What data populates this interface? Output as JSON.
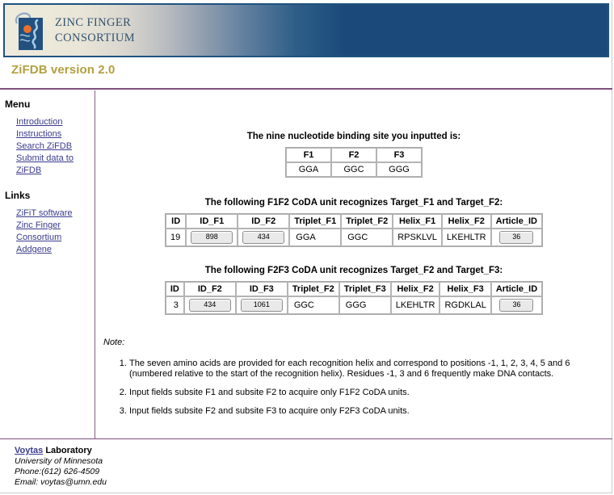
{
  "banner": {
    "title": "ZINC FINGER\nCONSORTIUM",
    "logo_icon": "zinc-finger-logo-icon",
    "colors": {
      "dark_blue": "#1b4a7a",
      "cream": "#eeeadc",
      "text": "#33536f"
    }
  },
  "version_bar": {
    "text": "ZiFDB version 2.0",
    "color": "#b3a03f"
  },
  "sidebar": {
    "menu_heading": "Menu",
    "menu_items": [
      {
        "label": "Introduction"
      },
      {
        "label": "Instructions"
      },
      {
        "label": "Search ZiFDB"
      },
      {
        "label": "Submit data to ZiFDB"
      }
    ],
    "links_heading": "Links",
    "links_items": [
      {
        "label": "ZiFiT software"
      },
      {
        "label": "Zinc Finger Consortium"
      },
      {
        "label": "Addgene"
      }
    ],
    "link_color": "#3b3b8f"
  },
  "main": {
    "input_section": {
      "heading": "The nine nucleotide binding site you inputted is:",
      "headers": [
        "F1",
        "F2",
        "F3"
      ],
      "values": [
        "GGA",
        "GGC",
        "GGG"
      ]
    },
    "f1f2_section": {
      "heading": "The following F1F2 CoDA unit recognizes Target_F1 and Target_F2:",
      "headers": [
        "ID",
        "ID_F1",
        "ID_F2",
        "Triplet_F1",
        "Triplet_F2",
        "Helix_F1",
        "Helix_F2",
        "Article_ID"
      ],
      "row": {
        "id": "19",
        "id_f1": "898",
        "id_f2": "434",
        "triplet_f1": "GGA",
        "triplet_f2": "GGC",
        "helix_f1": "RPSKLVL",
        "helix_f2": "LKEHLTR",
        "article_id": "36"
      }
    },
    "f2f3_section": {
      "heading": "The following F2F3 CoDA unit recognizes Target_F2 and Target_F3:",
      "headers": [
        "ID",
        "ID_F2",
        "ID_F3",
        "Triplet_F2",
        "Triplet_F3",
        "Helix_F2",
        "Helix_F3",
        "Article_ID"
      ],
      "row": {
        "id": "3",
        "id_f2": "434",
        "id_f3": "1061",
        "triplet_f2": "GGC",
        "triplet_f3": "GGG",
        "helix_f2": "LKEHLTR",
        "helix_f3": "RGDKLAL",
        "article_id": "36"
      }
    },
    "note": {
      "label": "Note:",
      "items": [
        "The seven amino acids are provided for each recognition helix and correspond to positions -1, 1, 2, 3, 4, 5 and 6 (numbered relative to the start of the recognition helix). Residues -1, 3 and 6 frequently make DNA contacts.",
        "Input fields subsite F1 and subsite F2 to acquire only F1F2 CoDA units.",
        "Input fields subsite F2 and subsite F3 to acquire only F2F3 CoDA units."
      ]
    }
  },
  "footer": {
    "lab_link": "Voytas",
    "lab_suffix": " Laboratory",
    "university": "University of Minnesota",
    "phone": "Phone:(612) 626-4509",
    "email": "Email: voytas@umn.edu"
  }
}
